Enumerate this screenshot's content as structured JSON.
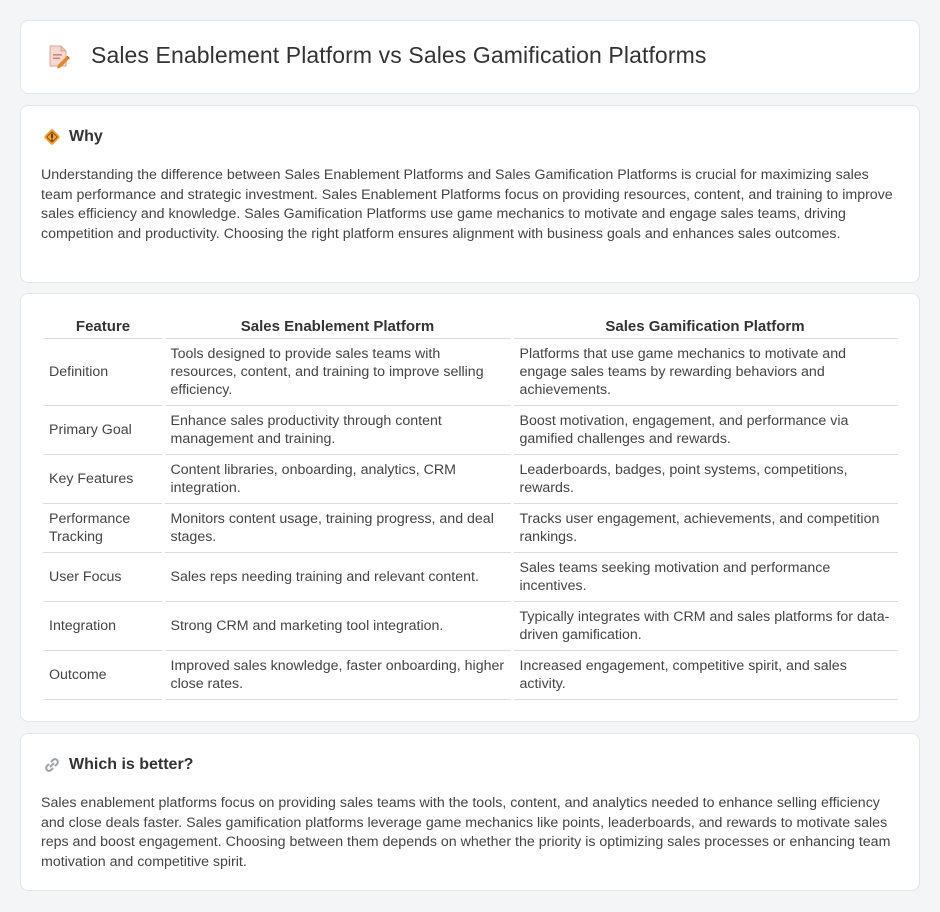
{
  "header": {
    "title": "Sales Enablement Platform vs Sales Gamification Platforms",
    "icon": "document-pencil-icon"
  },
  "why": {
    "icon": "diamond-sign-icon",
    "title": "Why",
    "body": "Understanding the difference between Sales Enablement Platforms and Sales Gamification Platforms is crucial for maximizing sales team performance and strategic investment. Sales Enablement Platforms focus on providing resources, content, and training to improve sales efficiency and knowledge. Sales Gamification Platforms use game mechanics to motivate and engage sales teams, driving competition and productivity. Choosing the right platform ensures alignment with business goals and enhances sales outcomes."
  },
  "table": {
    "headers": [
      "Feature",
      "Sales Enablement Platform",
      "Sales Gamification Platform"
    ],
    "rows": [
      {
        "feature": "Definition",
        "enablement": "Tools designed to provide sales teams with resources, content, and training to improve selling efficiency.",
        "gamification": "Platforms that use game mechanics to motivate and engage sales teams by rewarding behaviors and achievements."
      },
      {
        "feature": "Primary Goal",
        "enablement": "Enhance sales productivity through content management and training.",
        "gamification": "Boost motivation, engagement, and performance via gamified challenges and rewards."
      },
      {
        "feature": "Key Features",
        "enablement": "Content libraries, onboarding, analytics, CRM integration.",
        "gamification": "Leaderboards, badges, point systems, competitions, rewards."
      },
      {
        "feature": "Performance Tracking",
        "enablement": "Monitors content usage, training progress, and deal stages.",
        "gamification": "Tracks user engagement, achievements, and competition rankings."
      },
      {
        "feature": "User Focus",
        "enablement": "Sales reps needing training and relevant content.",
        "gamification": "Sales teams seeking motivation and performance incentives."
      },
      {
        "feature": "Integration",
        "enablement": "Strong CRM and marketing tool integration.",
        "gamification": "Typically integrates with CRM and sales platforms for data-driven gamification."
      },
      {
        "feature": "Outcome",
        "enablement": "Improved sales knowledge, faster onboarding, higher close rates.",
        "gamification": "Increased engagement, competitive spirit, and sales activity."
      }
    ]
  },
  "better": {
    "icon": "link-icon",
    "title": "Which is better?",
    "body": "Sales enablement platforms focus on providing sales teams with the tools, content, and analytics needed to enhance selling efficiency and close deals faster. Sales gamification platforms leverage game mechanics like points, leaderboards, and rewards to motivate sales reps and boost engagement. Choosing between them depends on whether the priority is optimizing sales processes or enhancing team motivation and competitive spirit."
  },
  "colors": {
    "background": "#f4f5f7",
    "card": "#ffffff",
    "border": "#e3e5e8",
    "text": "#444444",
    "icon_accent": "#e8842c"
  }
}
